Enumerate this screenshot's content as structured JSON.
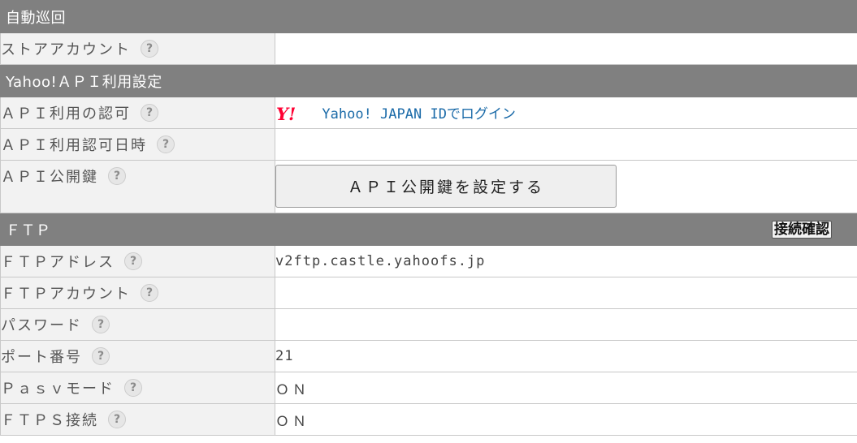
{
  "sections": {
    "auto": "自動巡回",
    "yahoo_api": "Yahoo!ＡＰＩ利用設定",
    "ftp": "ＦＴＰ"
  },
  "help_glyph": "?",
  "rows": {
    "store_account": {
      "label": "ストアアカウント",
      "value": ""
    },
    "api_auth": {
      "label": "ＡＰＩ利用の認可",
      "link": "Yahoo! JAPAN IDでログイン",
      "logo": "Y!"
    },
    "api_auth_datetime": {
      "label": "ＡＰＩ利用認可日時",
      "value": ""
    },
    "api_public_key": {
      "label": "ＡＰＩ公開鍵",
      "button": "ＡＰＩ公開鍵を設定する"
    },
    "ftp_address": {
      "label": "ＦＴＰアドレス",
      "value": "v2ftp.castle.yahoofs.jp"
    },
    "ftp_account": {
      "label": "ＦＴＰアカウント",
      "value": ""
    },
    "password": {
      "label": "パスワード",
      "value": ""
    },
    "port": {
      "label": "ポート番号",
      "value": "21"
    },
    "pasv_mode": {
      "label": "Ｐａｓｖモード",
      "value": "ＯＮ"
    },
    "ftps": {
      "label": "ＦＴＰＳ接続",
      "value": "ＯＮ"
    }
  },
  "ftp_check_button": "接続確認",
  "colors": {
    "section_bg": "#808080",
    "label_bg": "#f2f2f2",
    "yahoo_red": "#ff0033",
    "link": "#1a6aa8"
  }
}
